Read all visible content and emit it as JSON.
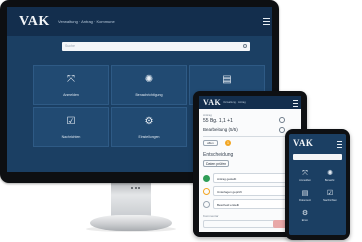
{
  "monitor": {
    "logo": "VAK",
    "subtitle": "Verwaltung · Antrag · Kommune",
    "search_placeholder": "Suche",
    "tiles": [
      {
        "label": "Anmelden",
        "icon": "⤧"
      },
      {
        "label": "Benachrichtigung",
        "icon": "✺"
      },
      {
        "label": "Dokument",
        "icon": "▤"
      },
      {
        "label": "Nachrichten",
        "icon": "☑"
      },
      {
        "label": "Einstellungen",
        "icon": "⚙"
      }
    ]
  },
  "tablet": {
    "logo": "VAK",
    "subtitle": "Verwaltung · Antrag",
    "field_label": "Antrag",
    "amount": "55 Bg. 1,1 +1",
    "status": "Bearbeitung (5/5)",
    "chip_a": "offen",
    "chip_b": "1",
    "section_title": "Entscheidung",
    "button_label": "Daten prüfen",
    "steps": [
      {
        "label": "Antrag gestellt"
      },
      {
        "label": "Unterlagen geprüft"
      },
      {
        "label": "Bescheid erstellt"
      }
    ],
    "footer_note": "Kommentar"
  },
  "phone": {
    "logo": "VAK",
    "tiles": [
      {
        "label": "Anmelden",
        "icon": "⤧"
      },
      {
        "label": "Benachr.",
        "icon": "✺"
      },
      {
        "label": "Dokument",
        "icon": "▤"
      },
      {
        "label": "Nachrichten",
        "icon": "☑"
      },
      {
        "label": "Einst.",
        "icon": "⚙"
      }
    ]
  }
}
